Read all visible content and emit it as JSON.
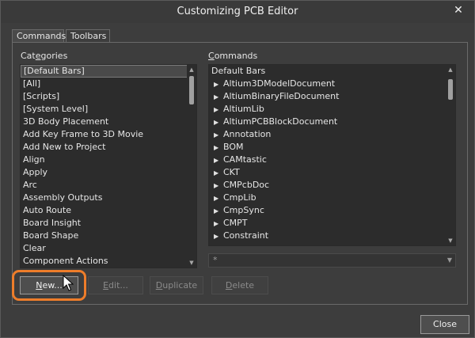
{
  "window": {
    "title": "Customizing PCB Editor",
    "close_glyph": "✕"
  },
  "tabs": [
    {
      "label": "Commands",
      "active": true
    },
    {
      "label": "Toolbars",
      "active": false
    }
  ],
  "categories": {
    "label_prefix": "Cat",
    "label_accel": "e",
    "label_suffix": "gories",
    "items": [
      "[Default Bars]",
      "[All]",
      "[Scripts]",
      "[System Level]",
      "3D Body Placement",
      "Add Key Frame to 3D Movie",
      "Add New to Project",
      "Align",
      "Apply",
      "Arc",
      "Assembly Outputs",
      "Auto Route",
      "Board Insight",
      "Board Shape",
      "Clear",
      "Component Actions"
    ],
    "selected_index": 0
  },
  "commands": {
    "label_prefix": "",
    "label_accel": "C",
    "label_suffix": "ommands",
    "header": "Default Bars",
    "items": [
      "Altium3DModelDocument",
      "AltiumBinaryFileDocument",
      "AltiumLib",
      "AltiumPCBBlockDocument",
      "Annotation",
      "BOM",
      "CAMtastic",
      "CKT",
      "CMPcbDoc",
      "CmpLib",
      "CmpSync",
      "CMPT",
      "Constraint"
    ]
  },
  "filter_combo": {
    "value": "*"
  },
  "buttons": {
    "new": {
      "accel": "N",
      "rest": "ew..."
    },
    "edit": {
      "accel": "E",
      "rest": "dit..."
    },
    "duplicate": {
      "pre": "",
      "accel": "D",
      "rest": "uplicate"
    },
    "delete": {
      "accel": "D",
      "rest": "elete"
    },
    "close": "Close"
  },
  "colors": {
    "highlight_ring": "#ee7d2a"
  }
}
